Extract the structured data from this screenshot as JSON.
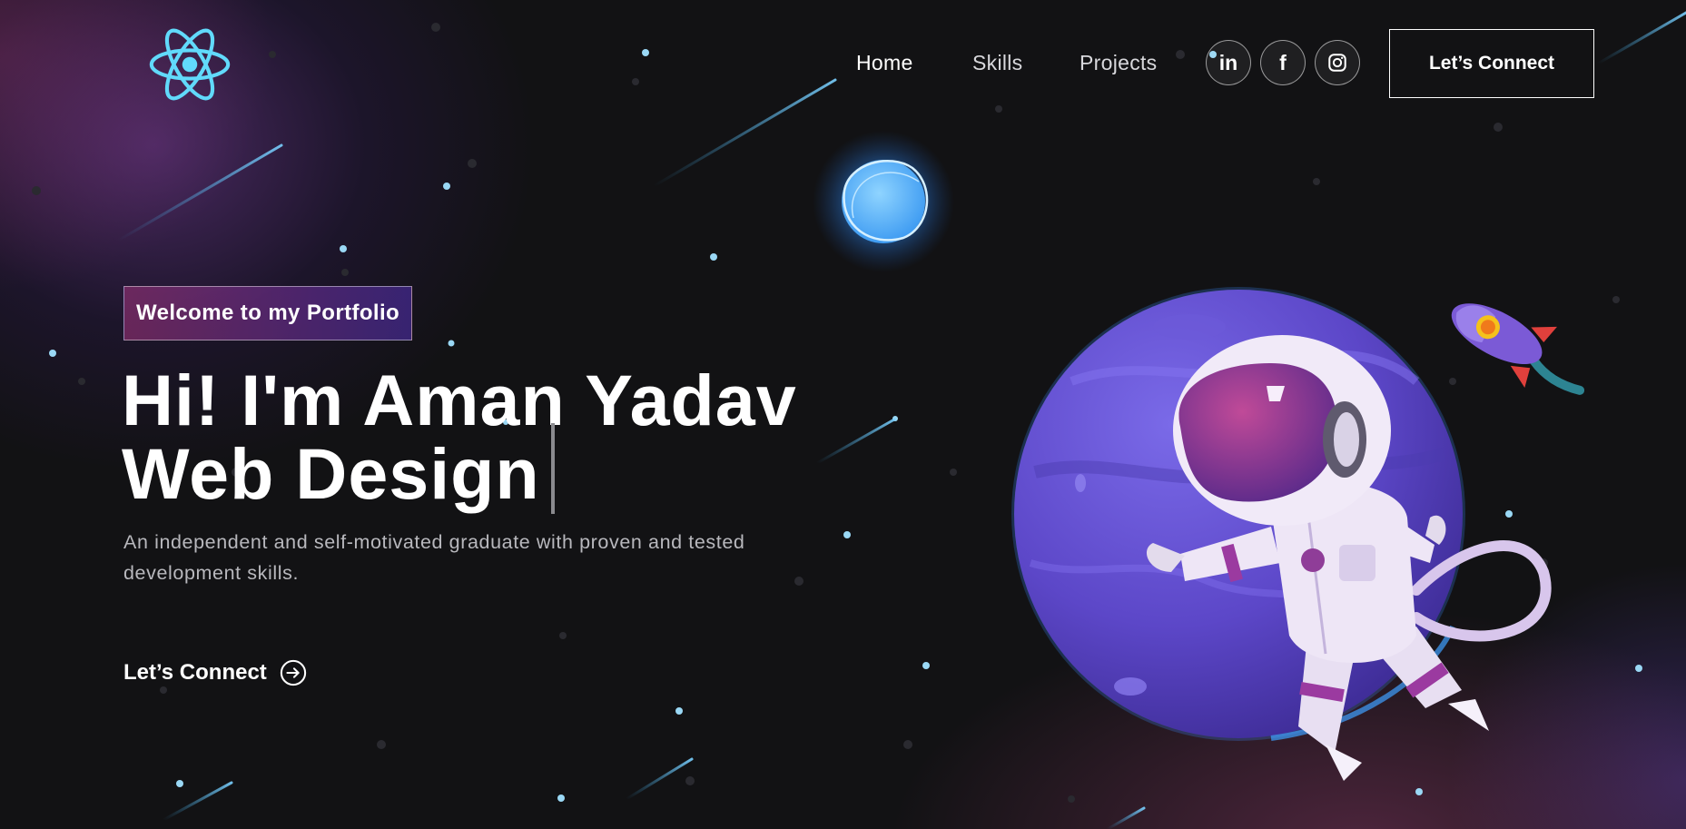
{
  "nav": {
    "links": [
      {
        "label": "Home",
        "active": true
      },
      {
        "label": "Skills",
        "active": false
      },
      {
        "label": "Projects",
        "active": false
      }
    ],
    "social": [
      {
        "icon": "linkedin-icon",
        "glyph": "in"
      },
      {
        "icon": "facebook-icon",
        "glyph": "f"
      },
      {
        "icon": "instagram-icon"
      }
    ],
    "connect_button": "Let’s Connect"
  },
  "hero": {
    "tagline": "Welcome to my Portfolio",
    "heading_line1": "Hi! I'm Aman Yadav",
    "heading_line2": "Web Design",
    "description": "An independent and self-motivated graduate with proven and tested development skills.",
    "cta_label": "Let’s Connect"
  },
  "colors": {
    "background": "#121214",
    "accent_cyan": "#61dafb",
    "tagline_gradient_start": "#AA367C",
    "tagline_gradient_end": "#4A2FBD",
    "planet": "#6a4fd6"
  },
  "icons": {
    "logo": "react-logo-icon",
    "cta": "arrow-right-circle-icon"
  }
}
